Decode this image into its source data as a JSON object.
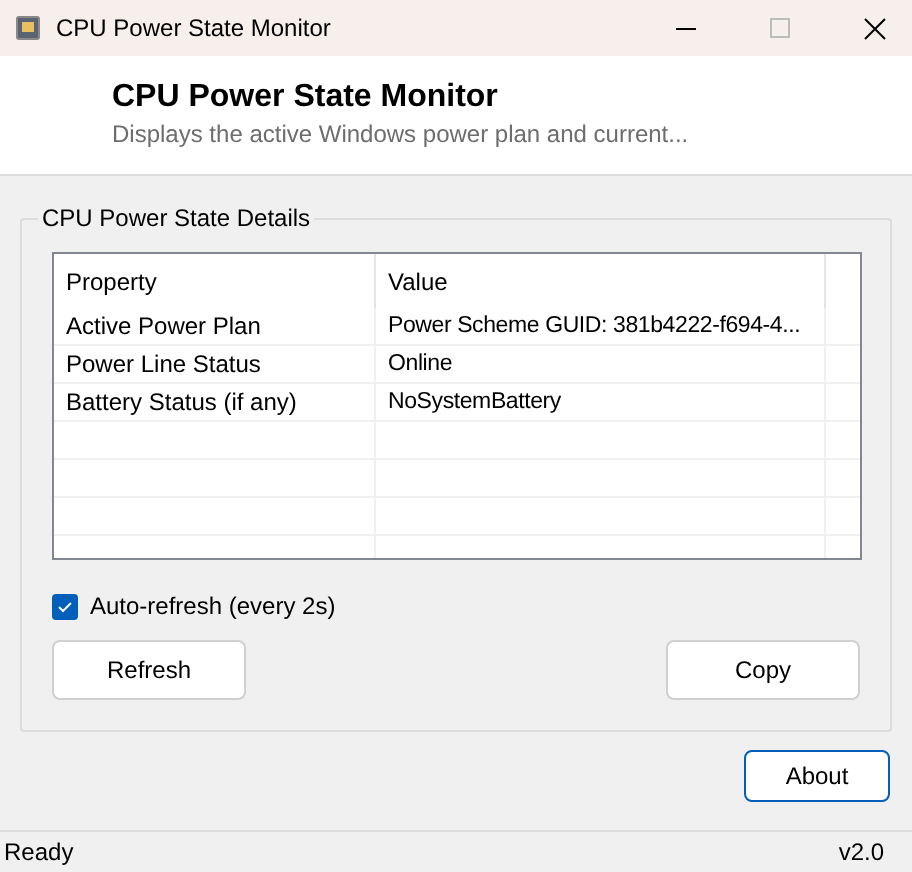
{
  "window": {
    "title": "CPU Power State Monitor"
  },
  "header": {
    "title": "CPU Power State Monitor",
    "subtitle": "Displays the active Windows power plan and current..."
  },
  "group": {
    "title": "CPU Power State Details",
    "table": {
      "columns": [
        "Property",
        "Value"
      ],
      "rows": [
        {
          "property": "Active Power Plan",
          "value": "Power Scheme GUID: 381b4222-f694-4..."
        },
        {
          "property": "Power Line Status",
          "value": "Online"
        },
        {
          "property": "Battery Status (if any)",
          "value": "NoSystemBattery"
        }
      ]
    },
    "auto_refresh": {
      "label": "Auto-refresh (every 2s)",
      "checked": true
    },
    "buttons": [
      "Refresh",
      "Copy"
    ]
  },
  "about_button": "About",
  "status_bar": {
    "status": "Ready",
    "version": "v2.0"
  }
}
